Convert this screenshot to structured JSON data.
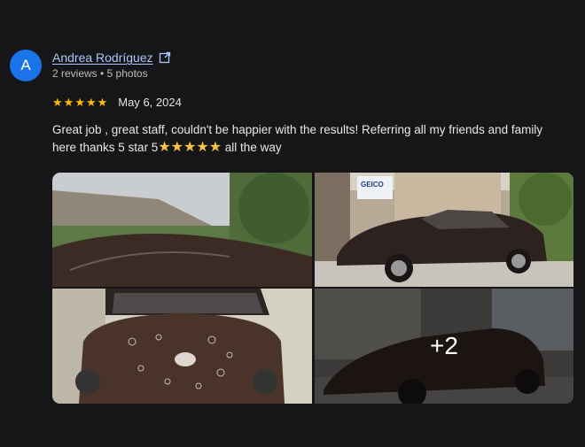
{
  "review": {
    "avatar_letter": "A",
    "author": "Andrea Rodríguez",
    "meta": "2 reviews • 5 photos",
    "rating": 5,
    "date": "May 6, 2024",
    "text_line1": "Great job , great staff, couldn't be happier with the results! Referring all my friends and family",
    "text_line2_start": "here thanks 5 star 5",
    "text_line2_end": " all the way",
    "photos": {
      "more_count": "+2",
      "sign_text": "GEICO"
    }
  },
  "colors": {
    "background": "#161619",
    "link": "#a8c7fa",
    "star": "#fbbc04",
    "avatar": "#1a73e8"
  }
}
